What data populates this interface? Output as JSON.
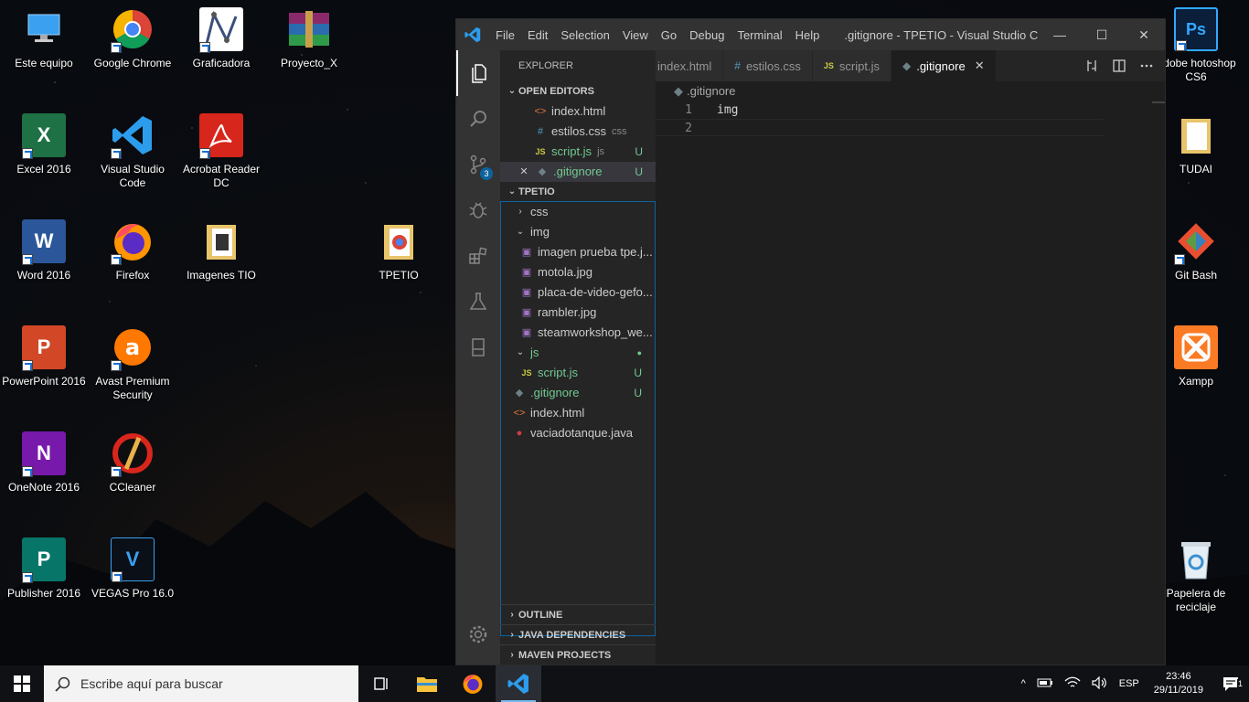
{
  "desktop": {
    "icons": [
      {
        "label": "Este equipo"
      },
      {
        "label": "Google Chrome"
      },
      {
        "label": "Graficadora"
      },
      {
        "label": "Proyecto_X"
      },
      {
        "label": "Excel 2016"
      },
      {
        "label": "Visual Studio Code"
      },
      {
        "label": "Acrobat Reader DC"
      },
      {
        "label": "Word 2016"
      },
      {
        "label": "Firefox"
      },
      {
        "label": "Imagenes TIO"
      },
      {
        "label": "TPETIO"
      },
      {
        "label": "PowerPoint 2016"
      },
      {
        "label": "Avast Premium Security"
      },
      {
        "label": "OneNote 2016"
      },
      {
        "label": "CCleaner"
      },
      {
        "label": "Publisher 2016"
      },
      {
        "label": "VEGAS Pro 16.0"
      },
      {
        "label": "Adobe hotoshop CS6"
      },
      {
        "label": "TUDAI"
      },
      {
        "label": "Git Bash"
      },
      {
        "label": "Xampp"
      },
      {
        "label": "Papelera de reciclaje"
      }
    ],
    "icon_glyphs": {
      "excel": "X",
      "word": "W",
      "powerpoint": "P",
      "onenote": "N",
      "publisher": "P",
      "vegas": "V",
      "avast": "a",
      "photoshop": "Ps"
    }
  },
  "vscode": {
    "menu": [
      "File",
      "Edit",
      "Selection",
      "View",
      "Go",
      "Debug",
      "Terminal",
      "Help"
    ],
    "window_title": ".gitignore - TPETIO - Visual Studio C...",
    "window_controls": {
      "minimize": "—",
      "maximize": "☐",
      "close": "✕"
    },
    "activity_badge": "3",
    "sidebar": {
      "title": "EXPLORER",
      "open_editors_header": "OPEN EDITORS",
      "open_editors": [
        {
          "icon": "<>",
          "name": "index.html",
          "desc": "",
          "status": ""
        },
        {
          "icon": "#",
          "name": "estilos.css",
          "desc": "css",
          "status": ""
        },
        {
          "icon": "JS",
          "name": "script.js",
          "desc": "js",
          "status": "U"
        },
        {
          "icon": "◆",
          "name": ".gitignore",
          "desc": "",
          "status": "U",
          "close": "✕"
        }
      ],
      "project_header": "TPETIO",
      "tree": [
        {
          "chev": "›",
          "name": "css"
        },
        {
          "chev": "⌄",
          "name": "img"
        },
        {
          "name": "imagen prueba tpe.j..."
        },
        {
          "name": "motola.jpg"
        },
        {
          "name": "placa-de-video-gefo..."
        },
        {
          "name": "rambler.jpg"
        },
        {
          "name": "steamworkshop_we..."
        },
        {
          "chev": "⌄",
          "name": "js",
          "status": "●"
        },
        {
          "icon": "JS",
          "name": "script.js",
          "status": "U"
        },
        {
          "icon": "◆",
          "name": ".gitignore",
          "status": "U"
        },
        {
          "icon": "<>",
          "name": "index.html"
        },
        {
          "icon": "●",
          "name": "vaciadotanque.java"
        }
      ],
      "bottom_sections": [
        "OUTLINE",
        "JAVA DEPENDENCIES",
        "MAVEN PROJECTS"
      ],
      "chev_right": "›"
    },
    "tabs": [
      {
        "icon": "",
        "label": "index.html"
      },
      {
        "icon": "#",
        "label": "estilos.css"
      },
      {
        "icon": "JS",
        "label": "script.js"
      },
      {
        "icon": "◆",
        "label": ".gitignore",
        "close": "✕"
      }
    ],
    "breadcrumb": ".gitignore",
    "breadcrumb_icon": "◆",
    "code_lines": [
      {
        "n": "1",
        "text": "img"
      },
      {
        "n": "2",
        "text": ""
      }
    ]
  },
  "taskbar": {
    "search_placeholder": "Escribe aquí para buscar",
    "language": "ESP",
    "time": "23:46",
    "date": "29/11/2019",
    "notification_count": "1",
    "tray_chevron": "^"
  },
  "colors": {
    "vscode_blue": "#0e639c",
    "git_untracked": "#73c991",
    "taskbar_accent": "#76b9ed"
  }
}
